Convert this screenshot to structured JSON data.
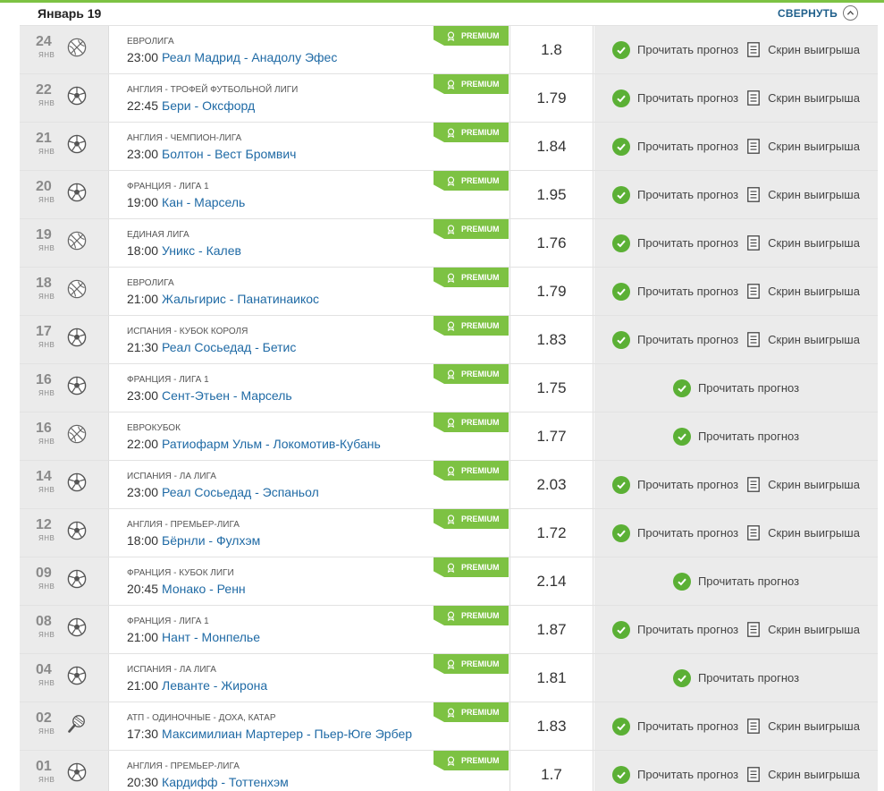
{
  "header": {
    "title": "Январь 19",
    "collapse_label": "СВЕРНУТЬ"
  },
  "labels": {
    "premium": "PREMIUM",
    "read_forecast": "Прочитать прогноз",
    "win_screen": "Скрин выигрыша"
  },
  "colors": {
    "accent_green": "#7dc243",
    "check_green": "#5bb035",
    "link_blue": "#1f6aa5"
  },
  "rows": [
    {
      "day": "24",
      "month": "ЯНВ",
      "sport": "basketball-icon",
      "league": "ЕВРОЛИГА",
      "time": "23:00",
      "match": "Реал Мадрид - Анадолу Эфес",
      "odds": "1.8",
      "has_screen": true
    },
    {
      "day": "22",
      "month": "ЯНВ",
      "sport": "soccer-ball-icon",
      "league": "АНГЛИЯ - ТРОФЕЙ ФУТБОЛЬНОЙ ЛИГИ",
      "time": "22:45",
      "match": "Бери - Оксфорд",
      "odds": "1.79",
      "has_screen": true
    },
    {
      "day": "21",
      "month": "ЯНВ",
      "sport": "soccer-ball-icon",
      "league": "АНГЛИЯ - ЧЕМПИОН-ЛИГА",
      "time": "23:00",
      "match": "Болтон - Вест Бромвич",
      "odds": "1.84",
      "has_screen": true
    },
    {
      "day": "20",
      "month": "ЯНВ",
      "sport": "soccer-ball-icon",
      "league": "ФРАНЦИЯ - ЛИГА 1",
      "time": "19:00",
      "match": "Кан - Марсель",
      "odds": "1.95",
      "has_screen": true
    },
    {
      "day": "19",
      "month": "ЯНВ",
      "sport": "basketball-icon",
      "league": "ЕДИНАЯ ЛИГА",
      "time": "18:00",
      "match": "Уникс - Калев",
      "odds": "1.76",
      "has_screen": true
    },
    {
      "day": "18",
      "month": "ЯНВ",
      "sport": "basketball-icon",
      "league": "ЕВРОЛИГА",
      "time": "21:00",
      "match": "Жальгирис - Панатинаикос",
      "odds": "1.79",
      "has_screen": true
    },
    {
      "day": "17",
      "month": "ЯНВ",
      "sport": "soccer-ball-icon",
      "league": "ИСПАНИЯ - КУБОК КОРОЛЯ",
      "time": "21:30",
      "match": "Реал Сосьедад - Бетис",
      "odds": "1.83",
      "has_screen": true
    },
    {
      "day": "16",
      "month": "ЯНВ",
      "sport": "soccer-ball-icon",
      "league": "ФРАНЦИЯ - ЛИГА 1",
      "time": "23:00",
      "match": "Сент-Этьен - Марсель",
      "odds": "1.75",
      "has_screen": false
    },
    {
      "day": "16",
      "month": "ЯНВ",
      "sport": "basketball-icon",
      "league": "ЕВРОКУБОК",
      "time": "22:00",
      "match": "Ратиофарм Ульм - Локомотив-Кубань",
      "odds": "1.77",
      "has_screen": false
    },
    {
      "day": "14",
      "month": "ЯНВ",
      "sport": "soccer-ball-icon",
      "league": "ИСПАНИЯ - ЛА ЛИГА",
      "time": "23:00",
      "match": "Реал Сосьедад - Эспаньол",
      "odds": "2.03",
      "has_screen": true
    },
    {
      "day": "12",
      "month": "ЯНВ",
      "sport": "soccer-ball-icon",
      "league": "АНГЛИЯ - ПРЕМЬЕР-ЛИГА",
      "time": "18:00",
      "match": "Бёрнли - Фулхэм",
      "odds": "1.72",
      "has_screen": true
    },
    {
      "day": "09",
      "month": "ЯНВ",
      "sport": "soccer-ball-icon",
      "league": "ФРАНЦИЯ - КУБОК ЛИГИ",
      "time": "20:45",
      "match": "Монако - Ренн",
      "odds": "2.14",
      "has_screen": false
    },
    {
      "day": "08",
      "month": "ЯНВ",
      "sport": "soccer-ball-icon",
      "league": "ФРАНЦИЯ - ЛИГА 1",
      "time": "21:00",
      "match": "Нант - Монпелье",
      "odds": "1.87",
      "has_screen": true
    },
    {
      "day": "04",
      "month": "ЯНВ",
      "sport": "soccer-ball-icon",
      "league": "ИСПАНИЯ - ЛА ЛИГА",
      "time": "21:00",
      "match": "Леванте - Жирона",
      "odds": "1.81",
      "has_screen": false
    },
    {
      "day": "02",
      "month": "ЯНВ",
      "sport": "tennis-racket-icon",
      "league": "АТП - ОДИНОЧНЫЕ - ДОХА, КАТАР",
      "time": "17:30",
      "match": "Максимилиан Мартерер - Пьер-Юге Эрбер",
      "odds": "1.83",
      "has_screen": true
    },
    {
      "day": "01",
      "month": "ЯНВ",
      "sport": "soccer-ball-icon",
      "league": "АНГЛИЯ - ПРЕМЬЕР-ЛИГА",
      "time": "20:30",
      "match": "Кардифф - Тоттенхэм",
      "odds": "1.7",
      "has_screen": true
    }
  ]
}
